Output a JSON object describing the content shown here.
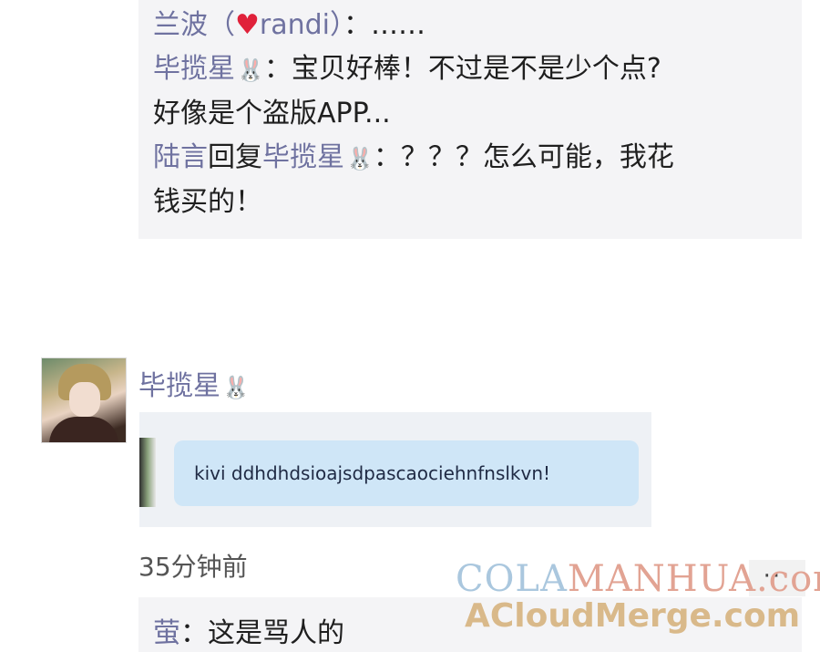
{
  "comments": {
    "line1": {
      "name": "兰波（",
      "heart": "♥",
      "name2": "randi",
      "name3": "）",
      "text": "：……"
    },
    "line2": {
      "name": "毕揽星",
      "rabbit": "🐰",
      "text": "：宝贝好棒！不过是不是少个点?"
    },
    "line3": {
      "text": "好像是个盗版APP..."
    },
    "line4": {
      "name": "陆言",
      "reply": "回复",
      "name2": "毕揽星",
      "rabbit": "🐰",
      "text": "：？？？怎么可能，我花"
    },
    "line5": {
      "text": "钱买的！"
    }
  },
  "post": {
    "author": "毕揽星",
    "author_rabbit": "🐰",
    "bubble_text": "kivi ddhdhdsioajsdpascaociehnfnslkvn!",
    "timestamp": "35分钟前",
    "more": "···"
  },
  "next_comment": {
    "name": "萤",
    "text": "：这是骂人的"
  },
  "watermark": {
    "line1a": "COLA",
    "line1b": "MANHUA.com",
    "line2": "ACloudMerge.com"
  }
}
